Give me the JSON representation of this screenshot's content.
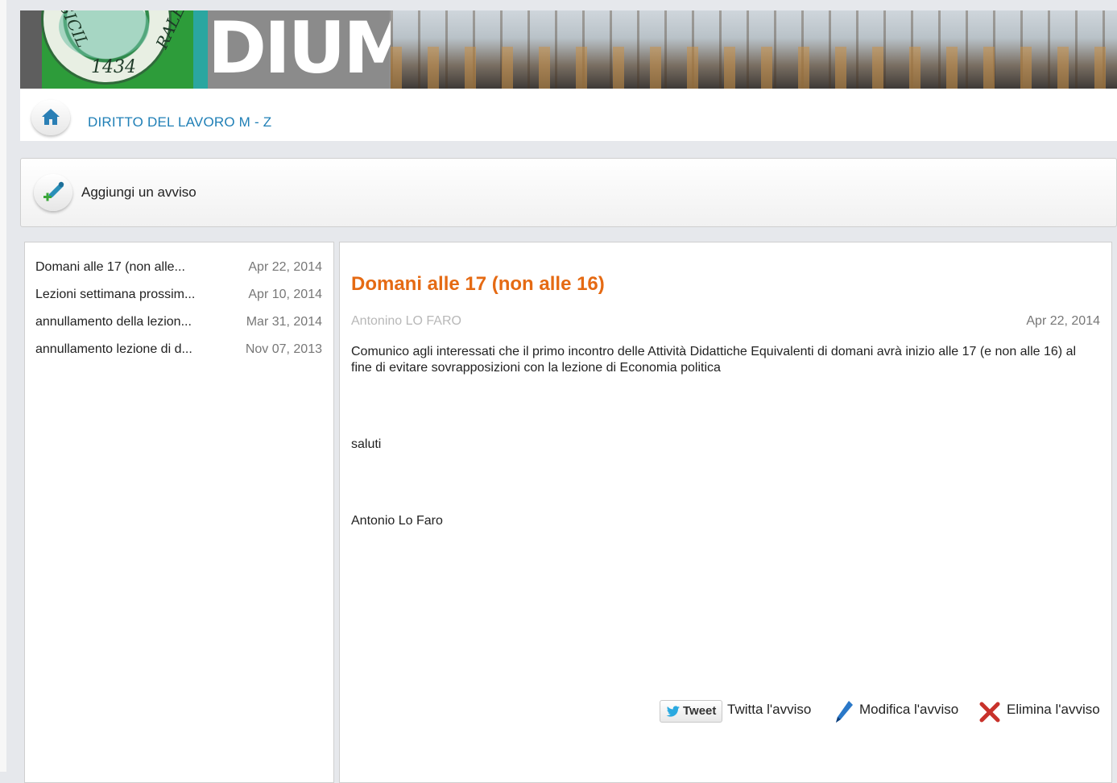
{
  "banner": {
    "seal_text_left": "SICIL",
    "seal_text_right": "RALE",
    "seal_year": "1434",
    "logo_text": "DIUM"
  },
  "breadcrumb": {
    "title": "DIRITTO DEL LAVORO M - Z"
  },
  "add_notice": {
    "label": "Aggiungi un avviso"
  },
  "notices": [
    {
      "title": "Domani alle 17 (non alle...",
      "date": "Apr 22, 2014"
    },
    {
      "title": "Lezioni settimana prossim...",
      "date": "Apr 10, 2014"
    },
    {
      "title": "annullamento della lezion...",
      "date": "Mar 31, 2014"
    },
    {
      "title": "annullamento lezione di d...",
      "date": "Nov 07, 2013"
    }
  ],
  "detail": {
    "title": "Domani alle 17 (non alle 16)",
    "author": "Antonino LO FARO",
    "date": "Apr 22, 2014",
    "body": "Comunico agli interessati che il primo incontro delle Attività Didattiche Equivalenti di domani avrà inizio alle 17 (e non alle 16) al fine di evitare sovrapposizioni con la lezione di Economia politica",
    "greeting": "saluti",
    "signature": "Antonio Lo Faro"
  },
  "actions": {
    "tweet_button": "Tweet",
    "tweet_label": "Twitta l'avviso",
    "edit_label": "Modifica l'avviso",
    "delete_label": "Elimina l'avviso"
  },
  "colors": {
    "accent_orange": "#e56a13",
    "link_blue": "#1f7fb6",
    "muted_text": "#777777"
  },
  "icons": [
    "home-icon",
    "add-notice-icon",
    "twitter-bird-icon",
    "pencil-icon",
    "delete-x-icon"
  ]
}
